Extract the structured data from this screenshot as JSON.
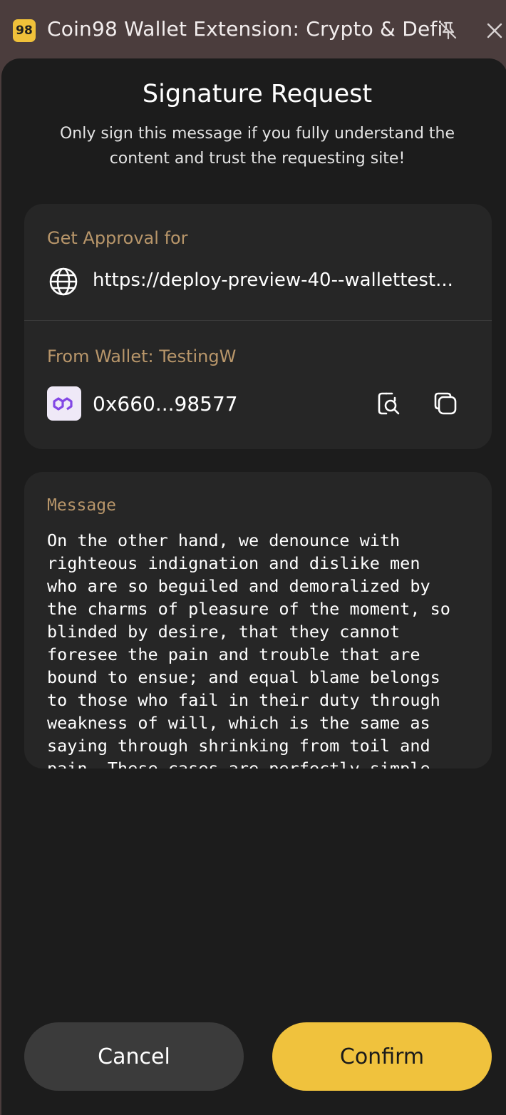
{
  "titlebar": {
    "logo_text": "98",
    "title": "Coin98 Wallet Extension: Crypto & Defi",
    "pin_icon": "pin-off-icon",
    "close_icon": "close-icon"
  },
  "header": {
    "title": "Signature Request",
    "subtitle": "Only sign this message if you fully understand the content and trust the requesting site!"
  },
  "approval": {
    "label": "Get Approval for",
    "site_icon": "globe-icon",
    "site_url": "https://deploy-preview-40--wallettest..."
  },
  "wallet": {
    "label": "From Wallet: TestingW",
    "network_icon": "polygon-icon",
    "address": "0x660...98577",
    "explorer_icon": "explorer-search-icon",
    "copy_icon": "copy-icon"
  },
  "message": {
    "label": "Message",
    "body": "On the other hand, we denounce with\nrighteous indignation and dislike men\nwho are so beguiled and demoralized by\nthe charms of pleasure of the moment, so\nblinded by desire, that they cannot\nforesee the pain and trouble that are\nbound to ensue; and equal blame belongs\nto those who fail in their duty through\nweakness of will, which is the same as\nsaying through shrinking from toil and\npain. These cases are perfectly simple"
  },
  "actions": {
    "cancel_label": "Cancel",
    "confirm_label": "Confirm"
  },
  "colors": {
    "accent": "#f0c23d",
    "label_gold": "#b8966a",
    "background": "#1c1c1c",
    "card": "#262626"
  }
}
